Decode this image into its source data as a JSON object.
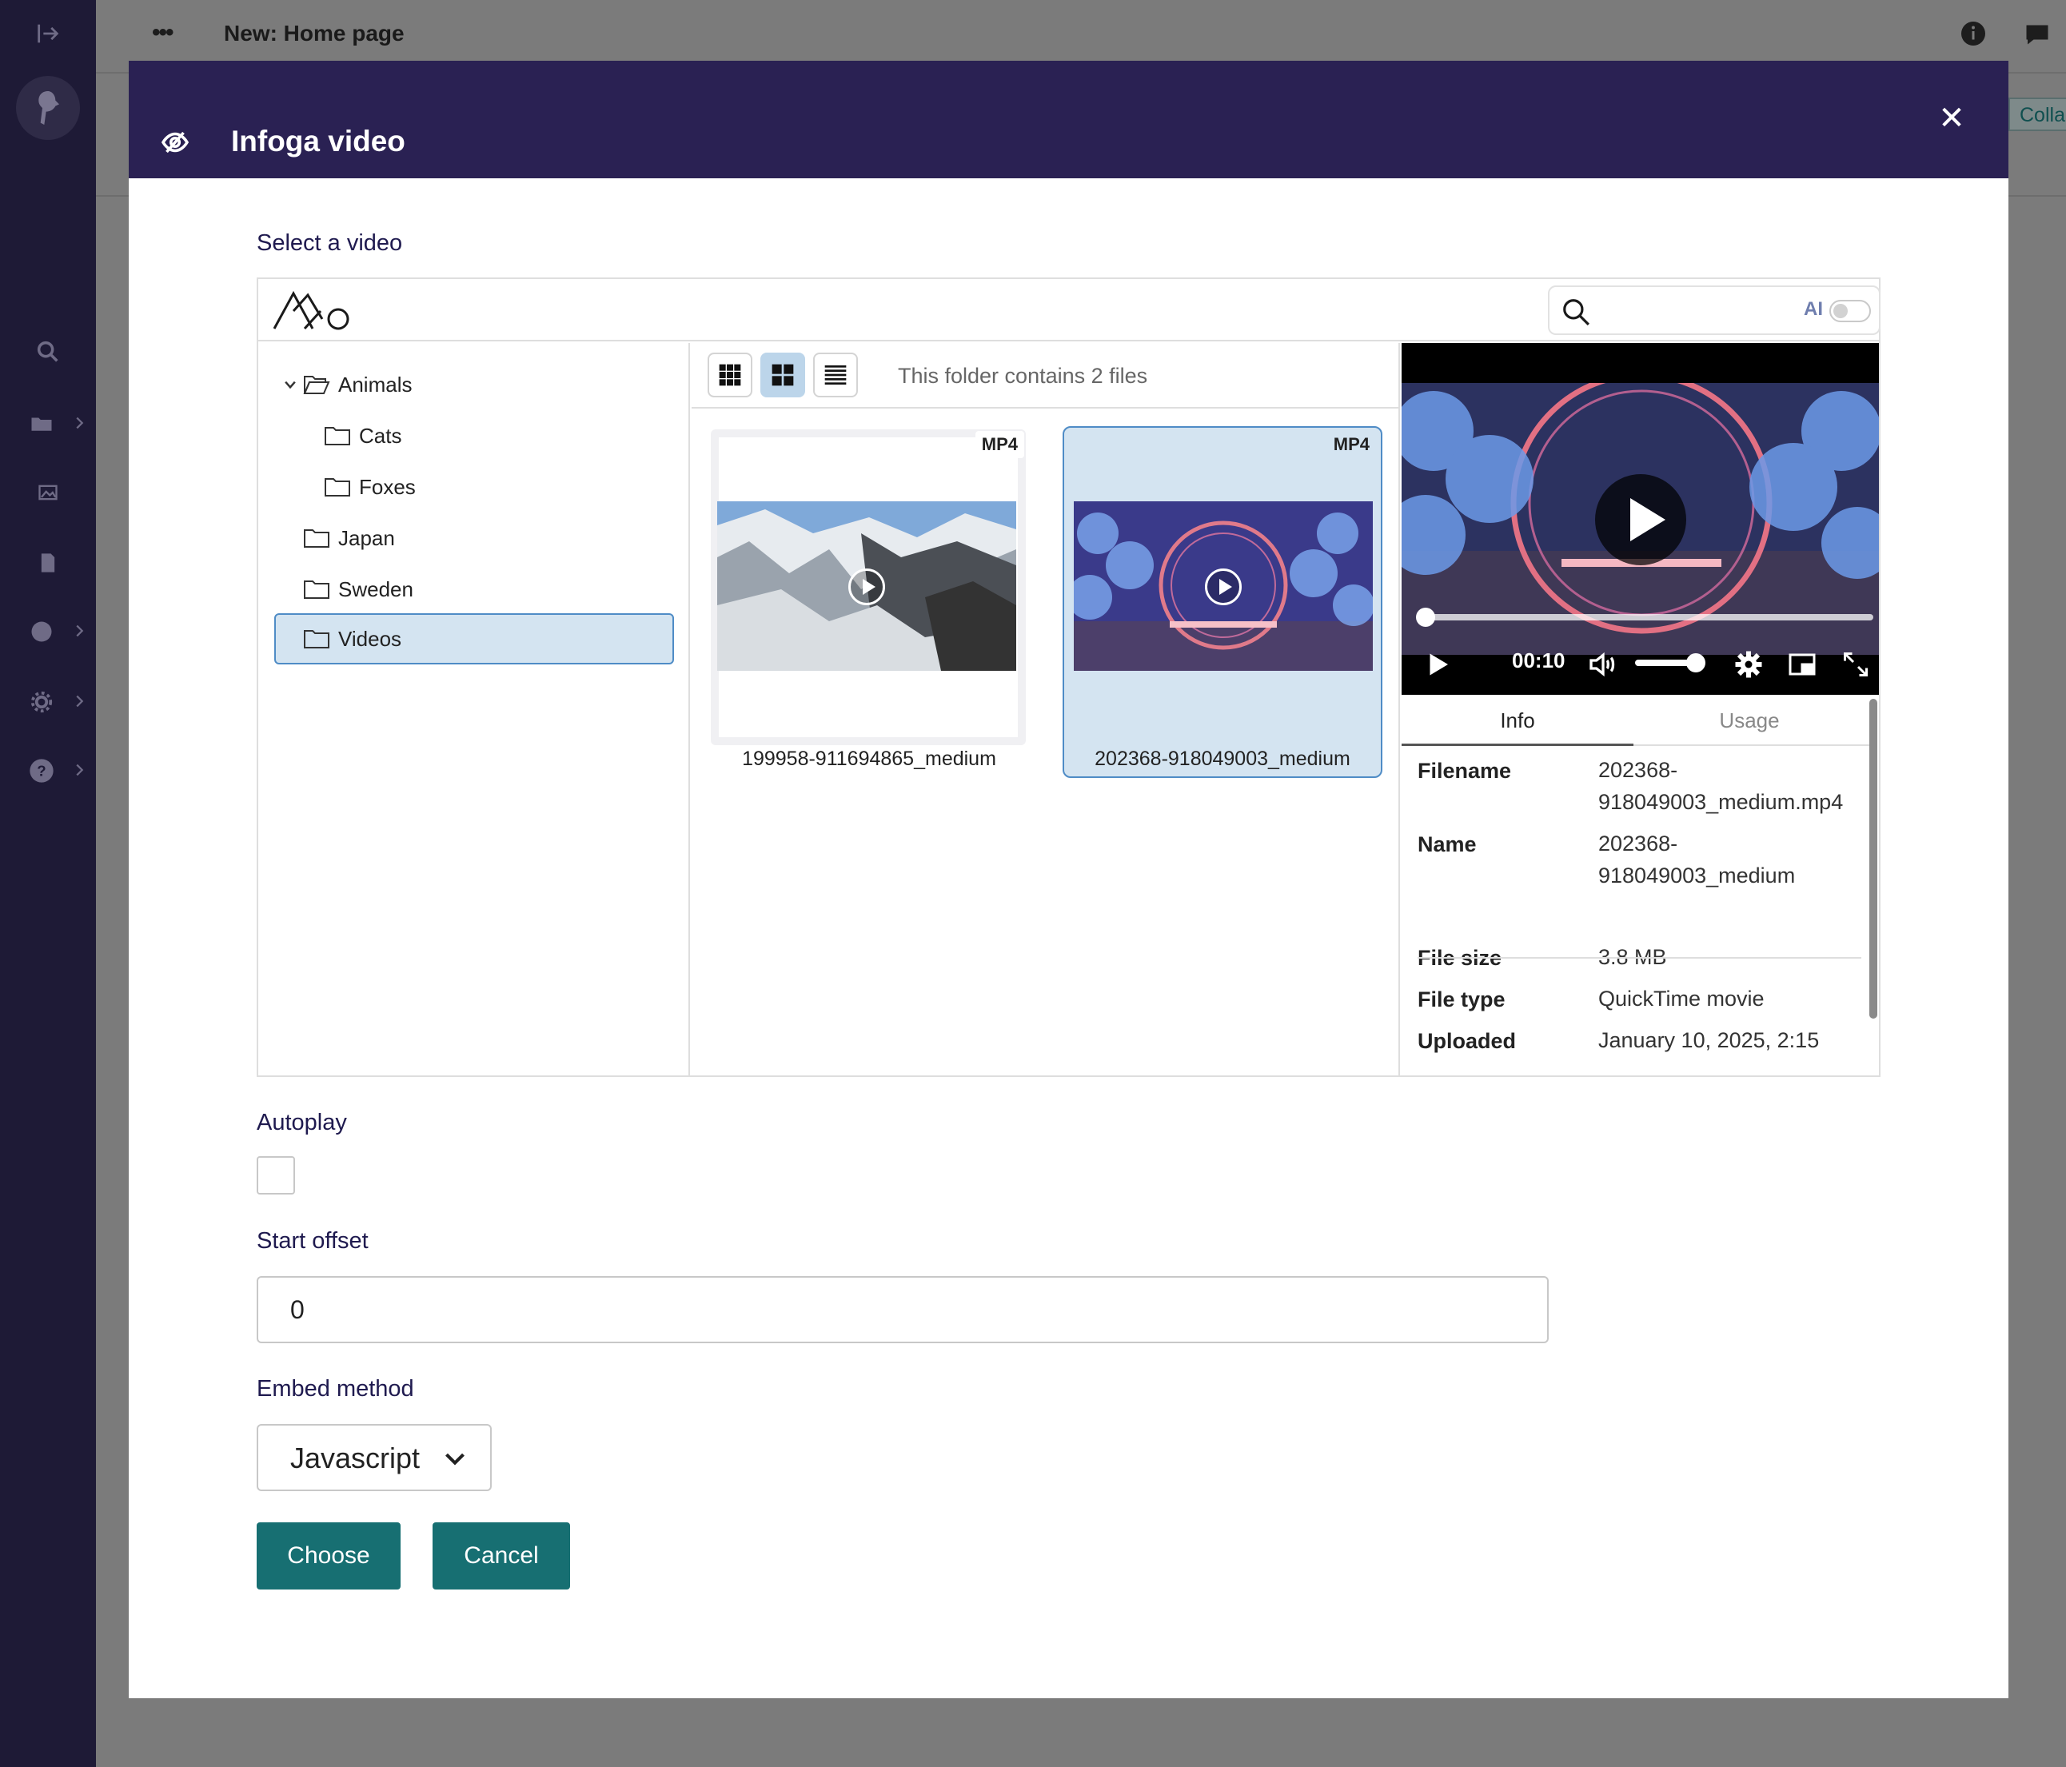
{
  "app": {
    "page_title": "New: Home page",
    "breadcrumb_dots": "•••",
    "collapse_label": "Collapse"
  },
  "modal": {
    "title": "Infoga video",
    "close_icon": "close-icon",
    "select_label": "Select a video",
    "search": {
      "placeholder": "",
      "ai_label": "AI",
      "ai_enabled": false
    },
    "tree": [
      {
        "label": "Animals",
        "expanded": true,
        "level": 0
      },
      {
        "label": "Cats",
        "level": 1
      },
      {
        "label": "Foxes",
        "level": 1
      },
      {
        "label": "Japan",
        "level": 0
      },
      {
        "label": "Sweden",
        "level": 0
      },
      {
        "label": "Videos",
        "level": 0,
        "selected": true
      }
    ],
    "folder_count": "This folder contains 2 files",
    "files": [
      {
        "name": "199958-911694865_medium",
        "badge": "MP4",
        "selected": false
      },
      {
        "name": "202368-918049003_medium",
        "badge": "MP4",
        "selected": true
      }
    ],
    "player": {
      "time": "00:10",
      "progress": 0.02,
      "volume": 0.9
    },
    "tabs": [
      "Info",
      "Usage"
    ],
    "info": [
      {
        "key": "Filename",
        "value": "202368-918049003_medium.mp4"
      },
      {
        "key": "Name",
        "value": "202368-918049003_medium"
      },
      {
        "key": "File size",
        "value": "3.8 MB"
      },
      {
        "key": "File type",
        "value": "QuickTime movie"
      },
      {
        "key": "Uploaded",
        "value": "January 10, 2025, 2:15"
      }
    ],
    "autoplay_label": "Autoplay",
    "autoplay_checked": false,
    "offset_label": "Start offset",
    "offset_value": "0",
    "embed_label": "Embed method",
    "embed_value": "Javascript",
    "choose_label": "Choose",
    "cancel_label": "Cancel"
  },
  "colors": {
    "header": "#2a2153",
    "sidebar": "#1e1a36",
    "accent_button": "#176f72",
    "selection": "#d4e4f1"
  }
}
